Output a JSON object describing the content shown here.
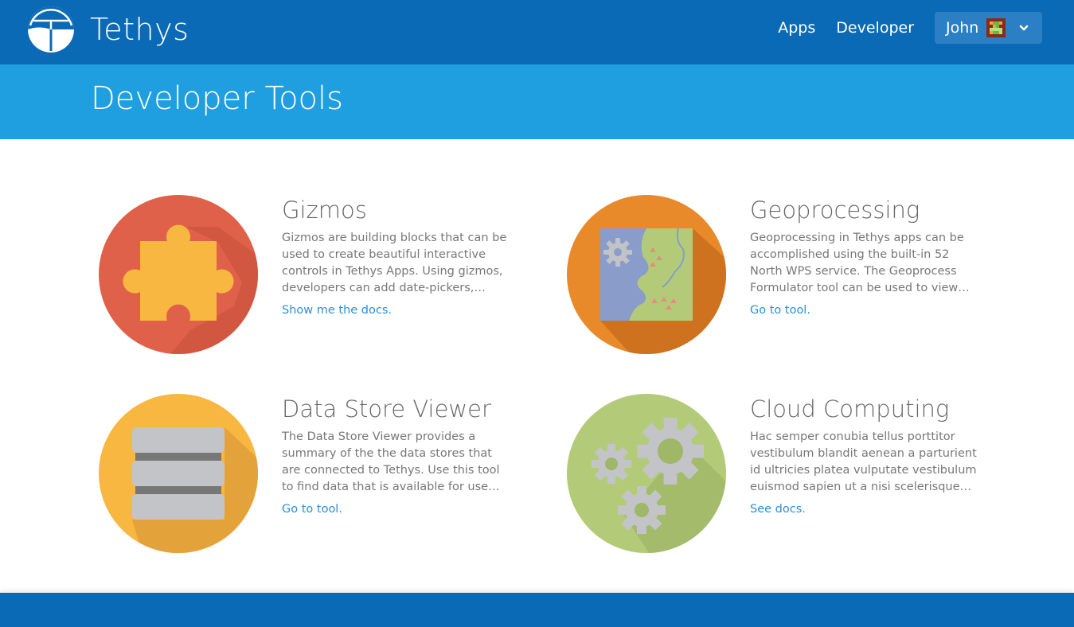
{
  "header": {
    "brand_name": "Tethys",
    "nav": {
      "apps": "Apps",
      "developer": "Developer"
    },
    "user": {
      "name": "John"
    }
  },
  "page": {
    "title": "Developer Tools"
  },
  "tools": [
    {
      "title": "Gizmos",
      "description": "Gizmos are building blocks that can be used to create beautiful interactive controls in Tethys Apps. Using gizmos, developers can add date-pickers, plot…",
      "link": "Show me the docs.",
      "icon": "puzzle-piece-icon",
      "color": "#e0614a"
    },
    {
      "title": "Geoprocessing",
      "description": "Geoprocessing in Tethys apps can be accomplished using the built-in 52 North WPS service. The Geoprocess Formulator tool can be used to view…",
      "link": "Go to tool.",
      "icon": "map-gear-icon",
      "color": "#e8892a"
    },
    {
      "title": "Data Store Viewer",
      "description": "The Data Store Viewer provides a summary of the the data stores that are connected to Tethys. Use this tool to find data that is available for use by…",
      "link": "Go to tool.",
      "icon": "database-icon",
      "color": "#f8b740"
    },
    {
      "title": "Cloud Computing",
      "description": "Hac semper conubia tellus porttitor vestibulum blandit aenean a parturient id ultricies platea vulputate vestibulum euismod sapien ut a nisi scelerisque p…",
      "link": "See docs.",
      "icon": "gears-icon",
      "color": "#b3cb79"
    }
  ],
  "colors": {
    "navbar": "#0b6ab5",
    "banner": "#1f9fe0",
    "link": "#2a8fd8"
  }
}
